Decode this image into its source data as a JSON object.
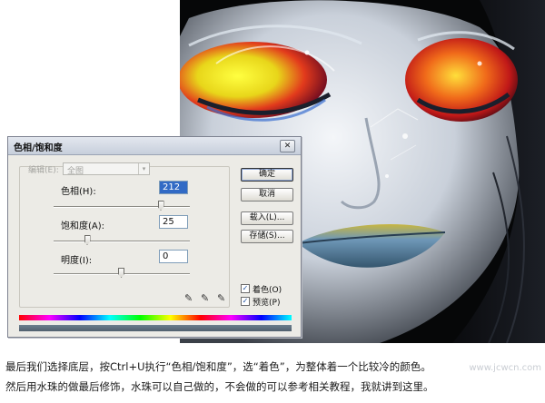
{
  "dialog": {
    "title": "色相/饱和度",
    "close_glyph": "✕",
    "edit": {
      "label": "编辑(E):",
      "value": "全图",
      "arrow_glyph": "▾"
    },
    "hue": {
      "label": "色相(H):",
      "value": "212",
      "level": 0.79
    },
    "saturation": {
      "label": "饱和度(A):",
      "value": "25",
      "level": 0.25
    },
    "lightness": {
      "label": "明度(I):",
      "value": "0",
      "level": 0.5
    },
    "buttons": {
      "ok": "确定",
      "cancel": "取消",
      "load": "载入(L)...",
      "save": "存储(S)..."
    },
    "colorize": {
      "label": "着色(O)",
      "checked": true,
      "glyph": "✓"
    },
    "preview": {
      "label": "预览(P)",
      "checked": true,
      "glyph": "✓"
    },
    "eyedropper_glyph": "✎",
    "icons": [
      "eyedropper-icon",
      "eyedropper-plus-icon",
      "eyedropper-minus-icon"
    ]
  },
  "caption": {
    "line1": "最后我们选择底层，按Ctrl+U执行“色相/饱和度”，选“着色”，为整体着一个比较冷的颜色。",
    "line2": "然后用水珠的做最后修饰，水珠可以自己做的，不会做的可以参考相关教程，我就讲到这里。"
  },
  "watermark": "www.jcwcn.com"
}
